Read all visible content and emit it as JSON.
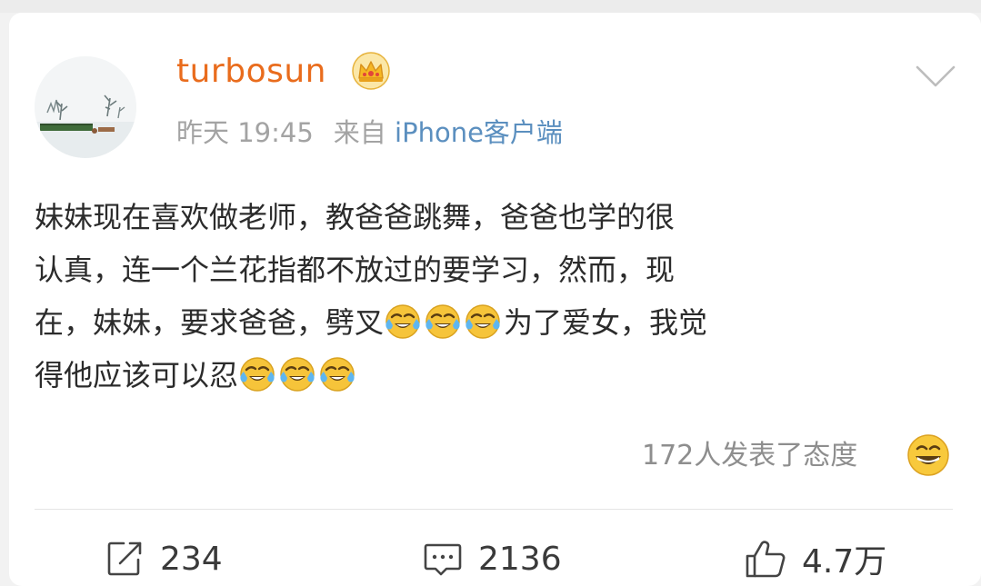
{
  "post": {
    "username": "turbosun",
    "time": "昨天 19:45",
    "source_prefix": "来自",
    "source": "iPhone客户端",
    "content_lines": [
      "妹妹现在喜欢做老师，教爸爸跳舞，爸爸也学的很",
      "认真，连一个兰花指都不放过的要学习，然而，现",
      "在，妹妹，要求爸爸，劈叉",
      "为了爱女，我觉",
      "得他应该可以忍"
    ],
    "emojis": {
      "laugh_cry": "laughing-crying-face-icon",
      "grin": "grinning-face-icon"
    },
    "reactions_text": "172人发表了态度",
    "icons": {
      "vip": "crown-vip-icon",
      "menu": "chevron-down-icon",
      "repost": "share-edit-icon",
      "comment": "comment-bubble-icon",
      "like": "thumbs-up-icon"
    }
  },
  "actions": {
    "repost_count": "234",
    "comment_count": "2136",
    "like_count": "4.7万"
  },
  "colors": {
    "username": "#e96c1d",
    "source_link": "#5b8fbf",
    "meta_text": "#a3a3a3",
    "body_text": "#2b2b2b"
  }
}
